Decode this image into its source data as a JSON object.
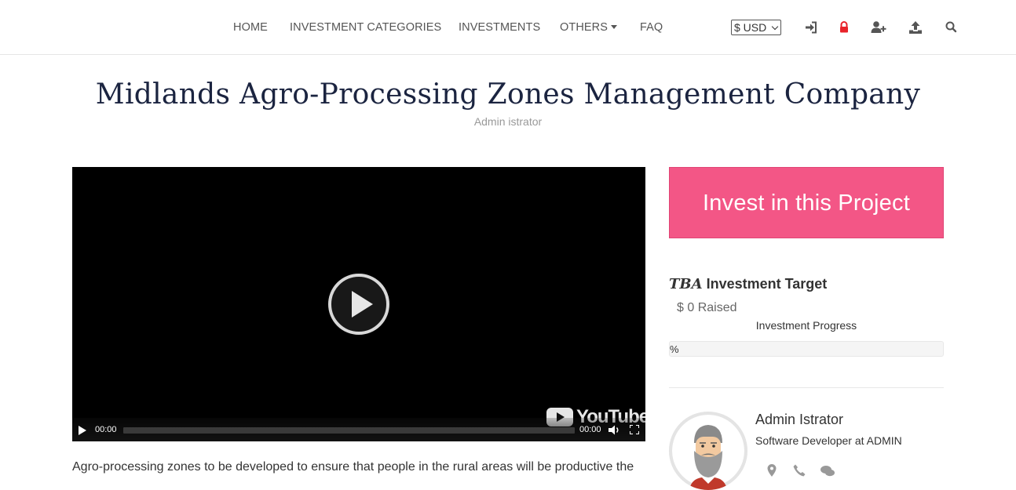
{
  "nav": {
    "items": [
      {
        "label": "HOME"
      },
      {
        "label": "INVESTMENT CATEGORIES"
      },
      {
        "label": "INVESTMENTS"
      },
      {
        "label": "OTHERS"
      },
      {
        "label": "FAQ"
      }
    ],
    "currency": {
      "selected": "$ USD"
    },
    "icons": [
      "sign-in-icon",
      "lock-icon",
      "user-plus-icon",
      "upload-icon",
      "search-icon"
    ]
  },
  "page": {
    "title": "Midlands Agro-Processing Zones Management Company",
    "subtitle": "Admin istrator"
  },
  "video": {
    "current_time": "00:00",
    "duration": "00:00",
    "provider": "YouTube"
  },
  "sidebar": {
    "invest_button": "Invest in this Project",
    "target_value": "TBA",
    "target_label": "Investment Target",
    "raised": "$ 0 Raised",
    "progress_label": "Investment Progress",
    "progress_text": "%",
    "progress_fraction": 0
  },
  "author": {
    "name": "Admin Istrator",
    "role": "Software Developer at ADMIN"
  },
  "description": "Agro-processing zones to be developed to ensure that people in the rural areas will be productive the",
  "colors": {
    "accent": "#f35686",
    "title": "#1b2440",
    "lock_icon": "#e8232a"
  }
}
